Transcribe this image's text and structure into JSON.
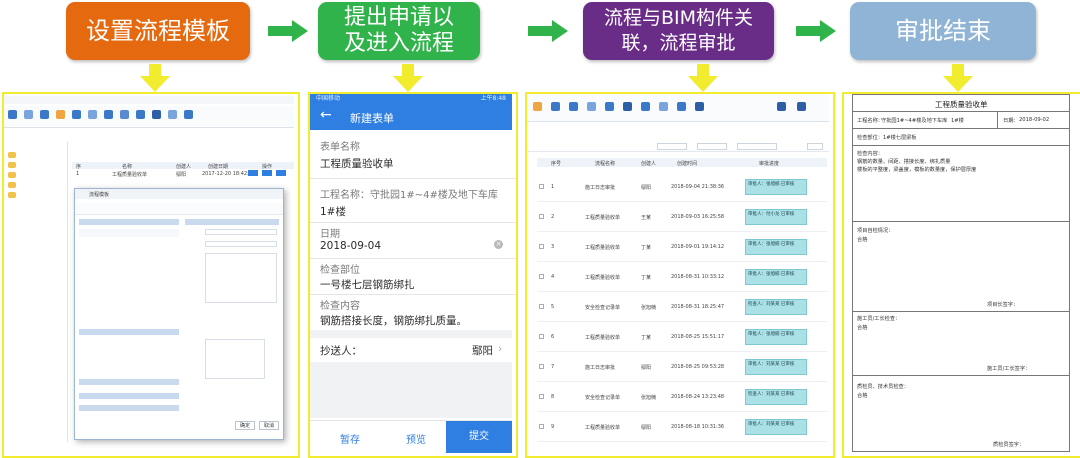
{
  "steps": [
    {
      "label": "设置流程模板",
      "color": "#e4690f"
    },
    {
      "label": "提出申请以\n及进入流程",
      "color": "#2fb34a"
    },
    {
      "label": "流程与BIM构件关\n联，流程审批",
      "color": "#6a2d87"
    },
    {
      "label": "审批结束",
      "color": "#8fb4d6"
    }
  ],
  "colors": {
    "arrow": "#2fb34a",
    "down_arrow": "#f2ec2e",
    "panel_border": "#f2ec2e",
    "mobile_header": "#2f7fe2"
  },
  "mobile": {
    "status_left": "中国移动",
    "status_right": "上午8:48",
    "title": "新建表单",
    "fields": [
      {
        "label": "表单名称",
        "value": "工程质量验收单"
      },
      {
        "label": "工程名称：守批园1#~4#楼及地下车库",
        "value": "1#楼"
      },
      {
        "label": "日期",
        "value": "2018-09-04"
      },
      {
        "label": "检查部位",
        "value": "一号楼七层钢筋绑扎"
      },
      {
        "label": "检查内容",
        "value": "钢筋搭接长度，钢筋绑扎质量。"
      }
    ],
    "cc_label": "抄送人：",
    "cc_value": "鄢阳",
    "buttons": [
      "暂存",
      "预览",
      "提交"
    ]
  },
  "doc": {
    "title": "工程质量验收单",
    "project_label": "工程名称：",
    "project_value": "守批园1#~4#楼及地下车库",
    "project_sub": "1#楼",
    "date_label": "日期：",
    "date_value": "2018-09-02",
    "location": "检查部位：1#楼七层梁板",
    "content_title": "检查内容：",
    "content_body_1": "钢筋的数量、间距、搭接长度、绑扎质量",
    "content_body_2": "楼板的平整度，梁盖度，模板的数量度，保护层厚度",
    "self_check": "项目自检情况：",
    "ok1": "合格",
    "sign1": "项目长签字：",
    "worker": "施工员/工长检查：",
    "ok2": "合格",
    "sign2": "施工员/工长签字：",
    "qc": "质检员、技术员检查：",
    "ok3": "合格",
    "sign3": "质检员签字："
  },
  "template_screen": {
    "table_header": [
      "序",
      "名称",
      "创建人",
      "创建日期",
      "操作"
    ],
    "row": [
      "1",
      "工程质量验收单",
      "鄢阳",
      "2017-12-20 18:42:1"
    ],
    "dialog_title": "流程模板",
    "dialog_buttons": [
      "确定",
      "取消"
    ]
  },
  "bim_screen": {
    "headers": [
      "序号",
      "流程名称",
      "创建人",
      "创建时间",
      "审批进度"
    ],
    "rows": [
      [
        "1",
        "施工日志审批",
        "鄢阳",
        "2018-09-04 21:38:36",
        "审批人：张旭楠 已审核"
      ],
      [
        "2",
        "工程质量验收单",
        "王某",
        "2018-09-03 16:25:58",
        "审批人：付小龙 已审核"
      ],
      [
        "3",
        "工程质量验收单",
        "丁某",
        "2018-09-01 19:14:12",
        "审批人：张旭楠 已审核"
      ],
      [
        "4",
        "工程质量验收单",
        "丁某",
        "2018-08-31 10:33:12",
        "审批人：张旭楠 已审核"
      ],
      [
        "5",
        "安全检查记录单",
        "张旭楠",
        "2018-08-31 18:25:47",
        "检查人：刘某某 已审核"
      ],
      [
        "6",
        "工程质量验收单",
        "丁某",
        "2018-08-25 15:51:17",
        "审批人：张旭楠 已审核"
      ],
      [
        "7",
        "施工日志审批",
        "鄢阳",
        "2018-08-25 09:53:28",
        "审批人：刘某某 已审核"
      ],
      [
        "8",
        "安全检查记录单",
        "张旭楠",
        "2018-08-24 13:23:48",
        "检查人：刘某某 已审核"
      ],
      [
        "9",
        "工程质量验收单",
        "鄢阳",
        "2018-08-18 10:31:36",
        "审批人：刘某某 已审核"
      ]
    ]
  }
}
